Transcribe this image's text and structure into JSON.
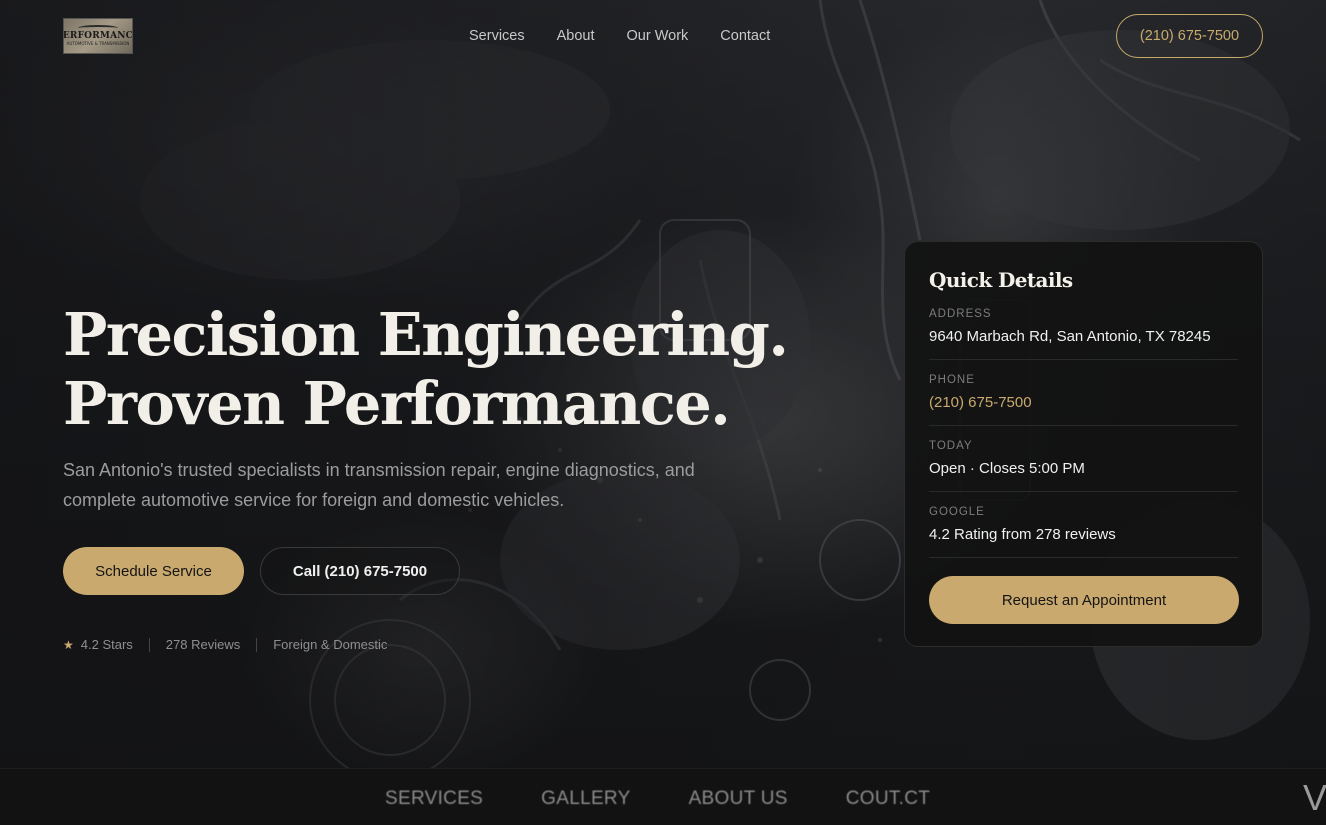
{
  "header": {
    "logo_text": "PERFORMANCE",
    "logo_subtext": "AUTOMOTIVE & TRANSMISSION",
    "nav": [
      "Services",
      "About",
      "Our Work",
      "Contact"
    ],
    "phone": "(210) 675-7500"
  },
  "hero": {
    "headline_line1": "Precision Engineering.",
    "headline_line2": "Proven Performance.",
    "subtitle": "San Antonio's trusted specialists in transmission repair, engine diagnostics, and complete automotive service for foreign and domestic vehicles.",
    "primary_button": "Schedule Service",
    "secondary_button": "Call (210) 675-7500",
    "meta": {
      "stars": "4.2 Stars",
      "reviews": "278 Reviews",
      "type": "Foreign & Domestic"
    }
  },
  "quick_details": {
    "title": "Quick Details",
    "rows": [
      {
        "label": "ADDRESS",
        "value": "9640 Marbach Rd, San Antonio, TX 78245"
      },
      {
        "label": "PHONE",
        "value": "(210) 675-7500"
      },
      {
        "label": "TODAY",
        "value": "Open · Closes 5:00 PM"
      },
      {
        "label": "GOOGLE",
        "value": "4.2 Rating from 278 reviews"
      }
    ],
    "button": "Request an Appointment"
  },
  "bottom_bar": {
    "links": [
      "SERVICES",
      "GALLERY",
      "ABOUT US",
      "COUT.CT"
    ],
    "edge_glyph": "V"
  },
  "colors": {
    "accent": "#c9a96d",
    "background": "#121212"
  }
}
